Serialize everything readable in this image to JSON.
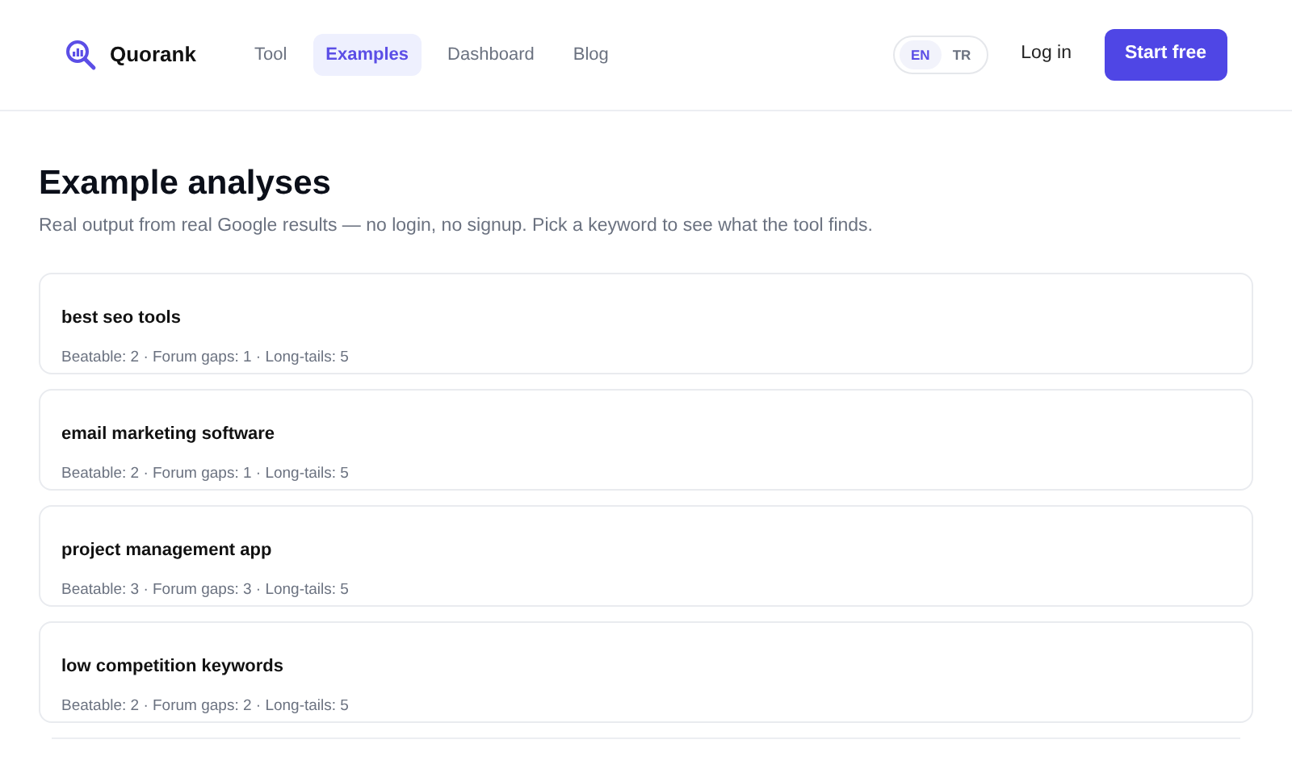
{
  "brand": "Quorank",
  "nav": [
    {
      "label": "Tool",
      "selected": false
    },
    {
      "label": "Examples",
      "selected": true
    },
    {
      "label": "Dashboard",
      "selected": false
    },
    {
      "label": "Blog",
      "selected": false
    }
  ],
  "languages": [
    {
      "label": "EN",
      "selected": true
    },
    {
      "label": "TR",
      "selected": false
    }
  ],
  "login": "Log in",
  "cta": "Start free",
  "heading": "Example analyses",
  "subtitle": "Real output from real Google results — no login, no signup. Pick a keyword to see what the tool finds.",
  "examples": [
    {
      "keyword": "best seo tools",
      "stats": "Beatable: 2 · Forum gaps: 1 · Long-tails: 5"
    },
    {
      "keyword": "email marketing software",
      "stats": "Beatable: 2 · Forum gaps: 1 · Long-tails: 5"
    },
    {
      "keyword": "project management app",
      "stats": "Beatable: 3 · Forum gaps: 3 · Long-tails: 5"
    },
    {
      "keyword": "low competition keywords",
      "stats": "Beatable: 2 · Forum gaps: 2 · Long-tails: 5"
    }
  ]
}
